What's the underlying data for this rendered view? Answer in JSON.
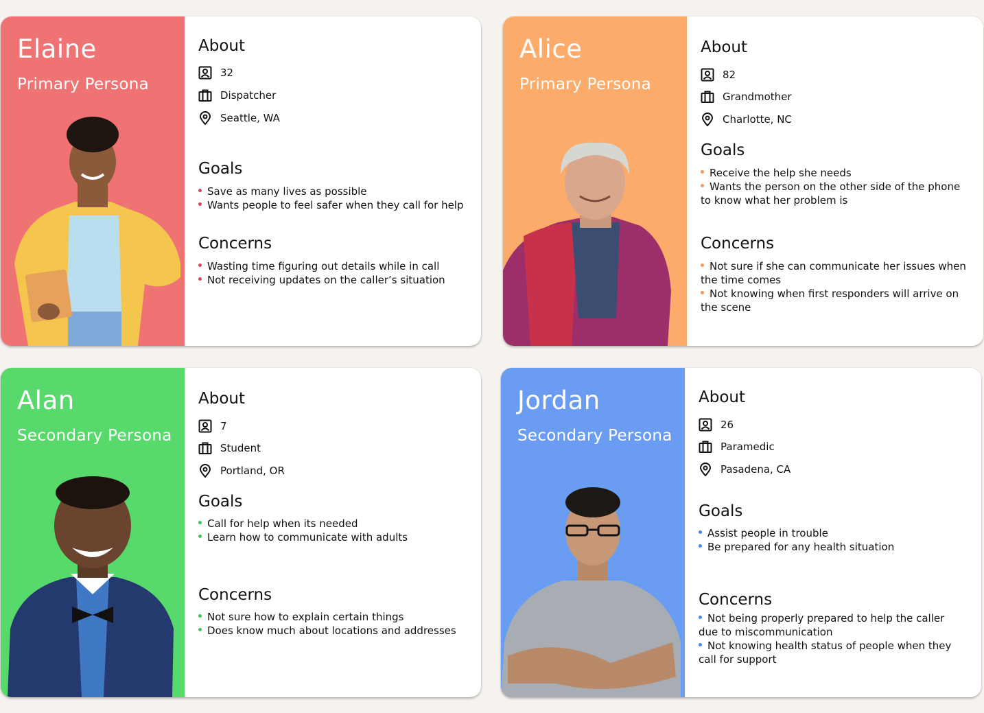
{
  "colors": {
    "page_bg": "#f6f2ed",
    "card_bg": "#ffffff"
  },
  "cards": [
    {
      "name": "Elaine",
      "role": "Primary Persona",
      "accent": "#ef7373",
      "bullet": "#e0445a",
      "about_heading": "About",
      "age": "32",
      "job": "Dispatcher",
      "location": "Seattle, WA",
      "goals_heading": "Goals",
      "goals": [
        "Save as many lives as possible",
        "Wants people to feel safer when they call for help"
      ],
      "concerns_heading": "Concerns",
      "concerns": [
        "Wasting time figuring out details while in call",
        "Not receiving updates on the caller’s situation"
      ]
    },
    {
      "name": "Alice",
      "role": "Primary Persona",
      "accent": "#fdab6b",
      "bullet": "#f59a52",
      "about_heading": "About",
      "age": "82",
      "job": "Grandmother",
      "location": "Charlotte, NC",
      "goals_heading": "Goals",
      "goals": [
        "Receive the help she needs",
        "Wants the person on the other side of the phone to know what her problem is"
      ],
      "concerns_heading": "Concerns",
      "concerns": [
        "Not sure if she can communicate her issues when the time comes",
        "Not knowing when first responders will arrive on the scene"
      ]
    },
    {
      "name": "Alan",
      "role": "Secondary Persona",
      "accent": "#57d96b",
      "bullet": "#3ec756",
      "about_heading": "About",
      "age": "7",
      "job": "Student",
      "location": "Portland, OR",
      "goals_heading": "Goals",
      "goals": [
        "Call for help when its needed",
        "Learn how to communicate with adults"
      ],
      "concerns_heading": "Concerns",
      "concerns": [
        "Not sure how to explain certain things",
        "Does know much about locations and addresses"
      ]
    },
    {
      "name": "Jordan",
      "role": "Secondary Persona",
      "accent": "#6a9df2",
      "bullet": "#4a86ec",
      "about_heading": "About",
      "age": "26",
      "job": "Paramedic",
      "location": "Pasadena, CA",
      "goals_heading": "Goals",
      "goals": [
        "Assist people in trouble",
        "Be prepared for any health situation"
      ],
      "concerns_heading": "Concerns",
      "concerns": [
        "Not being properly prepared to help the caller due to miscommunication",
        "Not knowing  health status of people when they call for support"
      ]
    }
  ]
}
